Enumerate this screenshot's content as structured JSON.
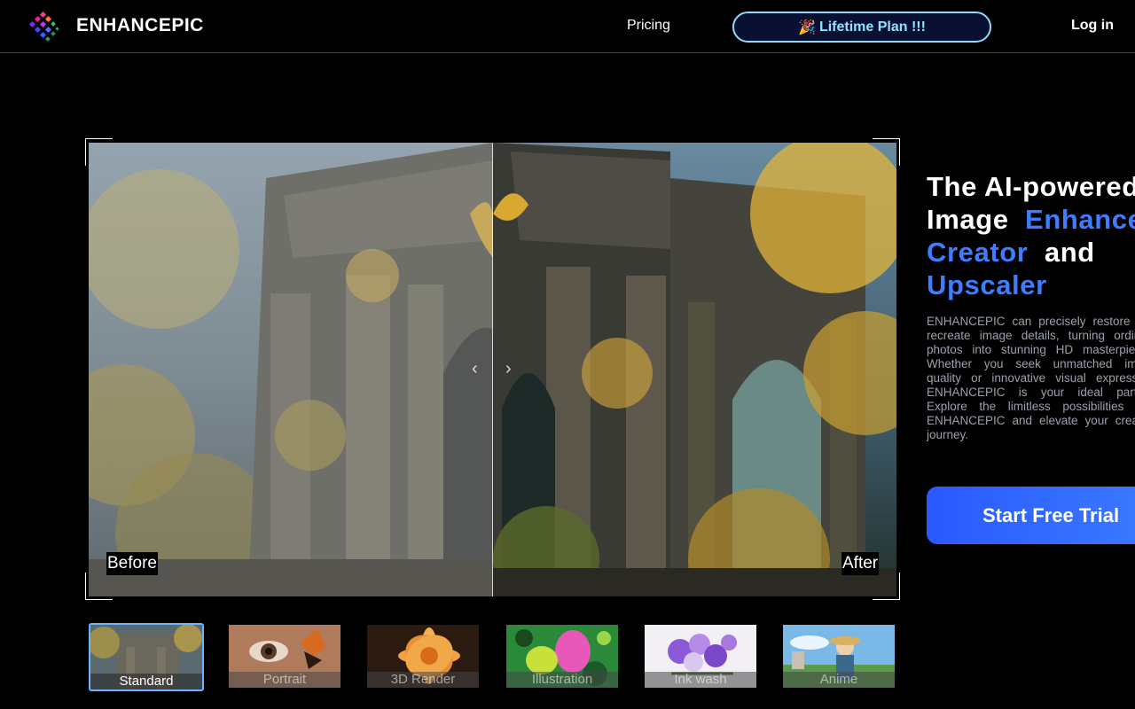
{
  "header": {
    "brand": "ENHANCEPIC",
    "nav_pricing": "Pricing",
    "lifetime_emoji": "🎉",
    "lifetime_label": "Lifetime Plan !!!",
    "login": "Log in"
  },
  "viewer": {
    "before_label": "Before",
    "after_label": "After",
    "arrow_left": "‹",
    "arrow_right": "›"
  },
  "hero": {
    "title_part1": "The AI-powered",
    "title_part2": "Image",
    "title_accent1": "Enhancer",
    "title_accent2": "Creator",
    "title_part3": "and",
    "title_accent3": "Upscaler",
    "description": "ENHANCEPIC can precisely restore and recreate image details, turning ordinary photos into stunning HD masterpieces. Whether you seek unmatched image quality or innovative visual expression, ENHANCEPIC is your ideal partner. Explore the limitless possibilities with ENHANCEPIC and elevate your creative journey.",
    "cta_label": "Start Free Trial"
  },
  "styles": [
    {
      "label": "Standard",
      "active": true
    },
    {
      "label": "Portrait",
      "active": false
    },
    {
      "label": "3D Render",
      "active": false
    },
    {
      "label": "Illustration",
      "active": false
    },
    {
      "label": "Ink wash",
      "active": false
    },
    {
      "label": "Anime",
      "active": false
    }
  ],
  "colors": {
    "accent": "#3f7dff",
    "cta": "#2a59ff",
    "lifetime_border": "#8fd9ff",
    "header_border": "#2b3aa8"
  }
}
